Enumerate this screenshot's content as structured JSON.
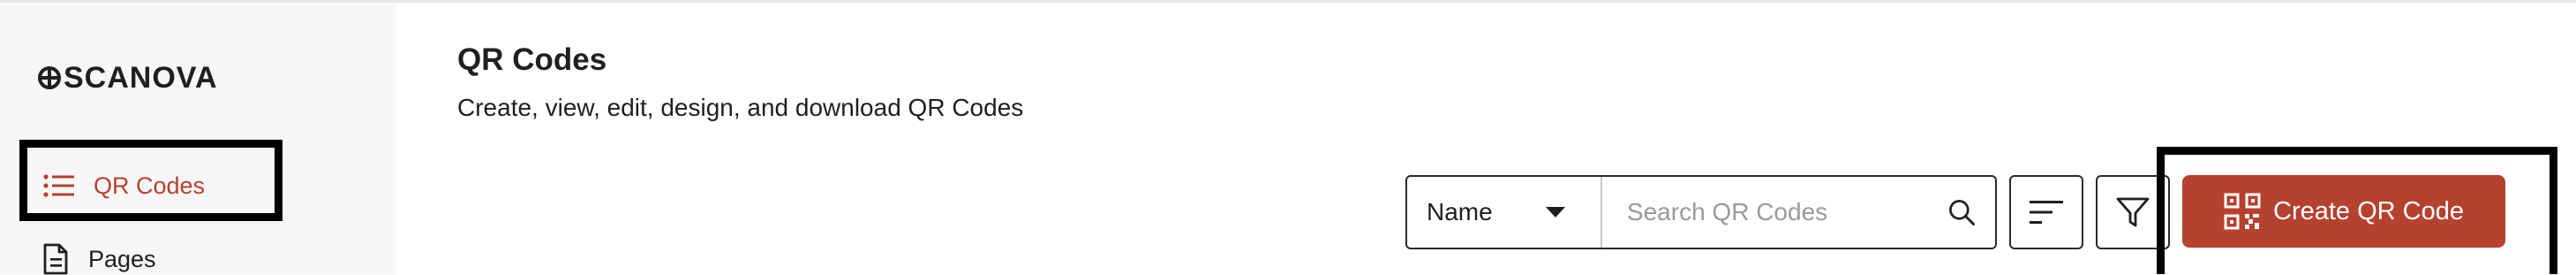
{
  "app": {
    "logo_text": "SCANOVA"
  },
  "sidebar": {
    "items": [
      {
        "label": "QR Codes",
        "icon": "list-icon",
        "active": true
      },
      {
        "label": "Pages",
        "icon": "document-icon",
        "active": false
      }
    ]
  },
  "header": {
    "title": "QR Codes",
    "subtitle": "Create, view, edit, design, and download QR Codes"
  },
  "toolbar": {
    "search_field_select": {
      "value": "Name"
    },
    "search": {
      "placeholder": "Search QR Codes",
      "value": ""
    },
    "sort_icon": "sort-lines-icon",
    "filter_icon": "funnel-icon",
    "create_label": "Create QR Code"
  },
  "colors": {
    "accent": "#b5412f",
    "sidebar_bg": "#f7f7f7",
    "text": "#1f1f1f",
    "highlight_border": "#000000"
  }
}
